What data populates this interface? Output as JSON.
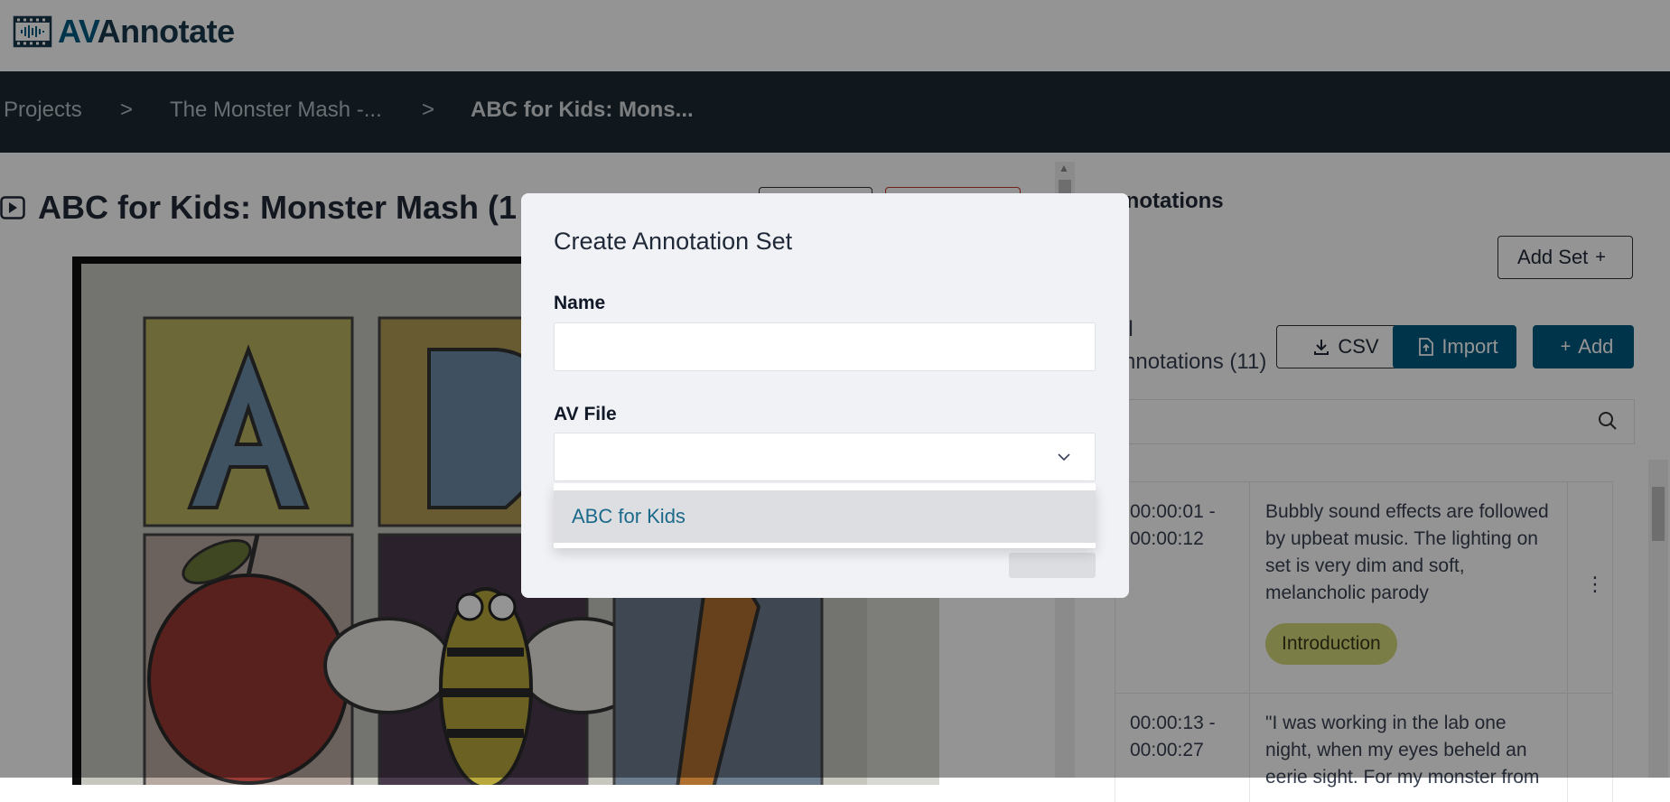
{
  "header": {
    "logo_av": "AV",
    "logo_rest": "Annotate",
    "logo_icon": "film-waveform-icon"
  },
  "breadcrumb": {
    "items": [
      {
        "label": "Projects"
      },
      {
        "label": "The Monster Mash -..."
      },
      {
        "label": "ABC for Kids: Mons..."
      }
    ],
    "separator": ">"
  },
  "media": {
    "title": "ABC for Kids: Monster Mash (1",
    "icon": "play-icon"
  },
  "annotations_panel": {
    "heading": "nnotations",
    "add_set_label": "Add Set",
    "add_set_icon": "+",
    "all_annotations_label": "ll\nnnotations (11)",
    "csv_label": "CSV",
    "import_label": "Import",
    "add_label": "Add",
    "add_icon": "+",
    "rows": [
      {
        "time": "00:00:01 -\n00:00:12",
        "text": "Bubbly sound effects are followed by upbeat music. The lighting on set is very dim and soft, melancholic parody",
        "tag": "Introduction"
      },
      {
        "time": "00:00:13 -\n00:00:27",
        "text": "\"I was working in the lab one night, when my eyes beheld an eerie sight. For my monster from"
      }
    ],
    "kebab": "⋮",
    "accent_color": "#005b82",
    "tag_color": "#d4d77a"
  },
  "modal": {
    "title": "Create Annotation Set",
    "name_label": "Name",
    "name_value": "",
    "av_file_label": "AV File",
    "av_file_value": "",
    "options": [
      "ABC for Kids"
    ]
  }
}
